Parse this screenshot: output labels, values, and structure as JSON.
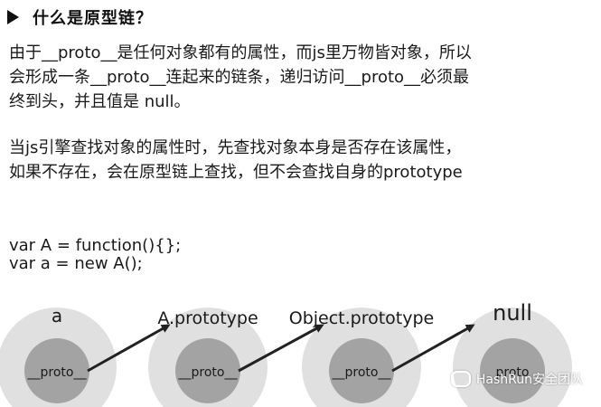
{
  "heading": {
    "icon": "triangle-right-icon",
    "title": "什么是原型链？"
  },
  "paragraph1": [
    "由于__proto__是任何对象都有的属性，而js里万物皆对象，所以",
    "会形成一条__proto__连起来的链条，递归访问__proto__必须最",
    "终到头，并且值是 null。"
  ],
  "paragraph2": [
    "当js引擎查找对象的属性时，先查找对象本身是否存在该属性，",
    "如果不存在，会在原型链上查找，但不会查找自身的prototype"
  ],
  "code": [
    "var A = function(){};",
    "var a = new A();"
  ],
  "diagram": {
    "nodes": [
      {
        "label": "a",
        "inner": "__proto__"
      },
      {
        "label": "A.prototype",
        "inner": "__proto__"
      },
      {
        "label": "Object.prototype",
        "inner": "__proto__"
      },
      {
        "label": "null",
        "inner": "proto"
      }
    ],
    "colors": {
      "outer": "#e0e0e0",
      "inner": "#a3a3a3",
      "arrow": "#222222"
    }
  },
  "watermark": {
    "icon": "wechat-icon",
    "text": "HashRun安全团队"
  }
}
